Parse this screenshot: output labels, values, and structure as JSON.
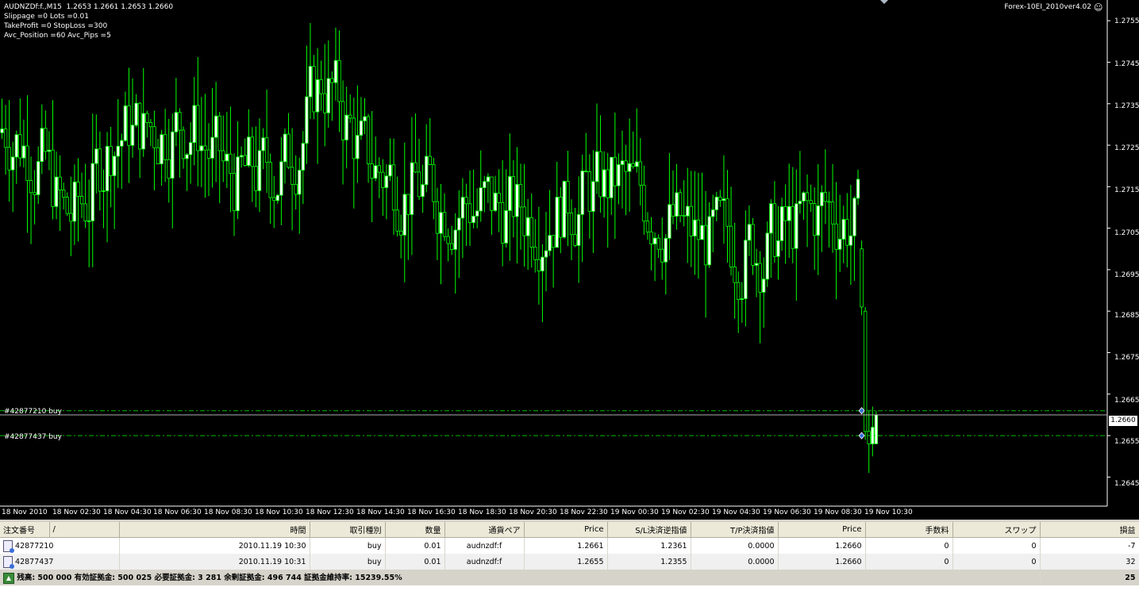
{
  "chart": {
    "header": "AUDNZDf:f.,M15  1.2653 1.2661 1.2653 1.2660",
    "params": [
      "Slippage =0 Lots =0.01",
      "TakeProfit =0 StopLoss =300",
      "Avc_Position =60 Avc_Pips =5"
    ],
    "expert_name": "Forex-10EI_2010ver4.02",
    "smiley_icon": "smiley-face-icon",
    "current_price": "1.2660",
    "orders": [
      {
        "label": "#42877210 buy",
        "price": 1.2661
      },
      {
        "label": "#42877437 buy",
        "price": 1.2655
      }
    ],
    "price_axis": [
      "1.2755",
      "1.2745",
      "1.2735",
      "1.2725",
      "1.2715",
      "1.2705",
      "1.2695",
      "1.2685",
      "1.2675",
      "1.2665",
      "1.2655",
      "1.2645"
    ],
    "time_axis": [
      "18 Nov 2010",
      "18 Nov 02:30",
      "18 Nov 04:30",
      "18 Nov 06:30",
      "18 Nov 08:30",
      "18 Nov 10:30",
      "18 Nov 12:30",
      "18 Nov 14:30",
      "18 Nov 16:30",
      "18 Nov 18:30",
      "18 Nov 20:30",
      "18 Nov 22:30",
      "19 Nov 00:30",
      "19 Nov 02:30",
      "19 Nov 04:30",
      "19 Nov 06:30",
      "19 Nov 08:30",
      "19 Nov 10:30"
    ],
    "colors": {
      "background": "#000000",
      "candle": "#00ff00",
      "bull_body": "#ffffff",
      "order_line": "#00c000"
    }
  },
  "chart_data": {
    "type": "candlestick",
    "price_min": 1.2638,
    "price_max": 1.276,
    "candle_seed": 7,
    "drop_candles": [
      {
        "open": 1.27,
        "high": 1.2702,
        "low": 1.2684,
        "close": 1.2686
      },
      {
        "open": 1.2685,
        "high": 1.2686,
        "low": 1.2654,
        "close": 1.2656
      },
      {
        "open": 1.2656,
        "high": 1.2661,
        "low": 1.2646,
        "close": 1.2653
      },
      {
        "open": 1.2653,
        "high": 1.2662,
        "low": 1.265,
        "close": 1.2657
      },
      {
        "open": 1.2653,
        "high": 1.2661,
        "low": 1.2653,
        "close": 1.266
      }
    ]
  },
  "terminal": {
    "columns": [
      "注文番号",
      "/",
      "時間",
      "取引種別",
      "数量",
      "通貨ペア",
      "Price",
      "S/L決済逆指値",
      "T/P決済指値",
      "Price",
      "手数料",
      "スワップ",
      "損益"
    ],
    "rows": [
      [
        "42877210",
        "2010.11.19 10:30",
        "buy",
        "0.01",
        "audnzdf:f",
        "1.2661",
        "1.2361",
        "0.0000",
        "1.2660",
        "0",
        "0",
        "-7"
      ],
      [
        "42877437",
        "2010.11.19 10:31",
        "buy",
        "0.01",
        "audnzdf:f",
        "1.2655",
        "1.2355",
        "0.0000",
        "1.2660",
        "0",
        "0",
        "32"
      ]
    ],
    "summary": "残高: 500 000  有効証拠金: 500 025  必要証拠金: 3 281  余剰証拠金: 496 744  証拠金維持率: 15239.55%",
    "summary_pl": "25"
  }
}
